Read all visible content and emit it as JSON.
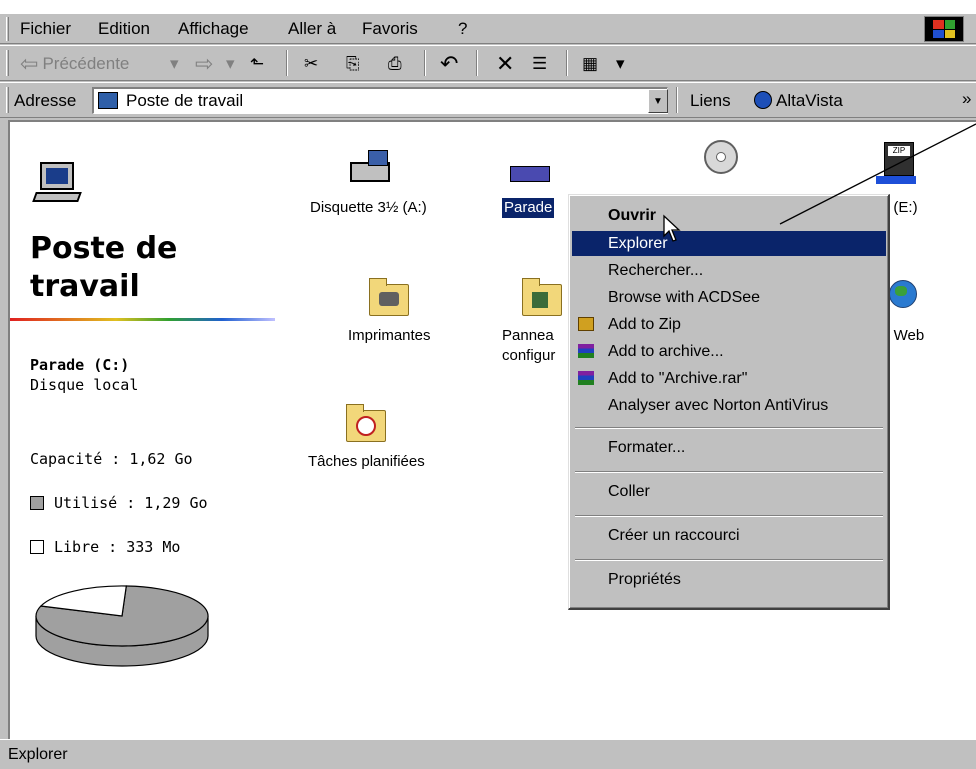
{
  "menubar": {
    "items": [
      "Fichier",
      "Edition",
      "Affichage",
      "Aller à",
      "Favoris",
      "?"
    ]
  },
  "toolbar": {
    "back_label": "Précédente",
    "back_arrow": "⇦",
    "dropdown_glyph": "▾",
    "forward_arrow": "⇨",
    "up_glyph": "⬑",
    "cut_glyph": "✂",
    "copy_glyph": "⎘",
    "paste_glyph": "⎙",
    "undo_glyph": "↶",
    "delete_glyph": "✕",
    "properties_glyph": "☰",
    "views_glyph": "▦"
  },
  "addressbar": {
    "label": "Adresse",
    "value": "Poste de travail",
    "links_label": "Liens",
    "links_item": "AltaVista",
    "more": "»",
    "drop_glyph": "▼"
  },
  "left_pane": {
    "title": "Poste de travail",
    "drive_name": "Parade (C:)",
    "drive_type": "Disque local",
    "capacity": "Capacité : 1,62 Go",
    "used": "Utilisé : 1,29 Go",
    "free": "Libre : 333 Mo",
    "used_fraction": 0.796,
    "colors": {
      "used": "#a0a0a0",
      "free": "#ffffff"
    }
  },
  "icons": {
    "floppy": "Disquette 3½ (A:)",
    "drive_c": "Parade",
    "drive_e": "D (E:)",
    "printers": "Imprimantes",
    "control_panel_1": "Pannea",
    "control_panel_2": "configur",
    "web": "s Web",
    "tasks": "Tâches planifiées"
  },
  "context_menu": {
    "items": [
      "Ouvrir",
      "Explorer",
      "Rechercher...",
      "Browse with ACDSee",
      "Add to Zip",
      "Add to archive...",
      "Add to \"Archive.rar\"",
      "Analyser avec Norton AntiVirus",
      "Formater...",
      "Coller",
      "Créer un raccourci",
      "Propriétés"
    ],
    "highlighted": "Explorer"
  },
  "statusbar": {
    "text": "Explorer"
  },
  "colors": {
    "selection": "#0a246a",
    "window_face": "#c0c0c0"
  }
}
